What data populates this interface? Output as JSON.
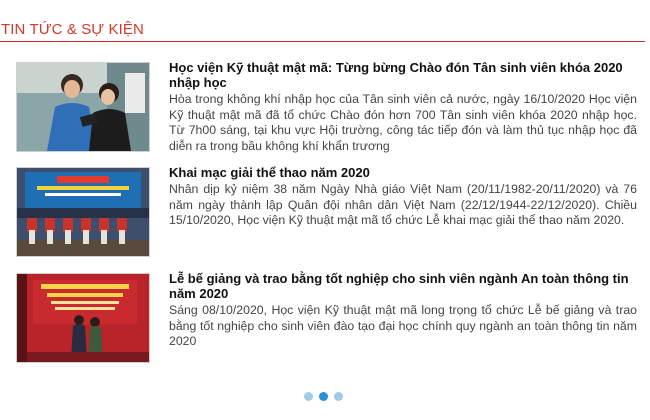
{
  "section": {
    "title": "TIN TỨC & SỰ KIỆN"
  },
  "news": [
    {
      "title": "Học viện Kỹ thuật mật mã: Từng bừng Chào đón Tân sinh viên khóa 2020 nhập học",
      "summary": "Hòa trong không khí nhập học của Tân sinh viên cả nước, ngày 16/10/2020 Học viện Kỹ thuật mật mã đã tổ chức Chào đón hơn 700 Tân sinh viên khóa 2020 nhập học. Từ 7h00 sáng, tại khu vực Hội trường, công tác tiếp đón và làm thủ tục nhập học đã diễn ra trong bầu không khí khẩn trương"
    },
    {
      "title": "Khai mạc giải thể thao năm 2020",
      "summary": "Nhân dịp kỷ niệm 38 năm Ngày Nhà giáo Việt Nam (20/11/1982-20/11/2020) và 76 năm ngày thành lập Quân đội nhân dân Việt Nam (22/12/1944-22/12/2020). Chiều 15/10/2020, Học viện Kỹ thuật mật mã tổ chức Lễ khai mạc giải thể thao năm 2020."
    },
    {
      "title": "Lễ bế giảng và trao bằng tốt nghiệp cho sinh viên ngành An toàn thông tin năm 2020",
      "summary": "Sáng 08/10/2020, Học viện Kỹ thuật mật mã long trọng tổ chức Lễ bế giảng và trao bằng tốt nghiệp cho sinh viên đào tạo đại học chính quy ngành an toàn thông tin năm 2020"
    }
  ],
  "pager": {
    "count": 3,
    "active_index": 1
  },
  "colors": {
    "section_title": "#d33a2c",
    "divider": "#cc2b2b",
    "dot": "#9ecbe8",
    "dot_active": "#2a8fd6"
  }
}
